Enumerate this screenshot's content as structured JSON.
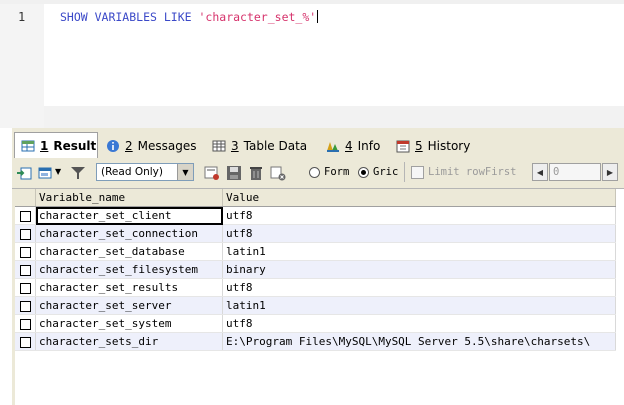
{
  "editor": {
    "line_number": "1",
    "sql_keyword": "SHOW VARIABLES LIKE",
    "sql_string": "'character_set_%'"
  },
  "tabs": [
    {
      "num": "1",
      "label": "Result",
      "icon": "result-grid-icon",
      "active": true
    },
    {
      "num": "2",
      "label": "Messages",
      "icon": "info-circle-icon",
      "active": false
    },
    {
      "num": "3",
      "label": "Table Data",
      "icon": "table-icon",
      "active": false
    },
    {
      "num": "4",
      "label": "Info",
      "icon": "info-bars-icon",
      "active": false
    },
    {
      "num": "5",
      "label": "History",
      "icon": "calendar-icon",
      "active": false
    }
  ],
  "toolbar": {
    "mode": "(Read Only)",
    "radio_form": "Form",
    "radio_grid": "Gric",
    "limit_label": "Limit rowFirst",
    "limit_first": "0"
  },
  "grid": {
    "columns": [
      "Variable_name",
      "Value"
    ],
    "rows": [
      [
        "character_set_client",
        "utf8"
      ],
      [
        "character_set_connection",
        "utf8"
      ],
      [
        "character_set_database",
        "latin1"
      ],
      [
        "character_set_filesystem",
        "binary"
      ],
      [
        "character_set_results",
        "utf8"
      ],
      [
        "character_set_server",
        "latin1"
      ],
      [
        "character_set_system",
        "utf8"
      ],
      [
        "character_sets_dir",
        "E:\\Program Files\\MySQL\\MySQL Server 5.5\\share\\charsets\\"
      ]
    ]
  }
}
